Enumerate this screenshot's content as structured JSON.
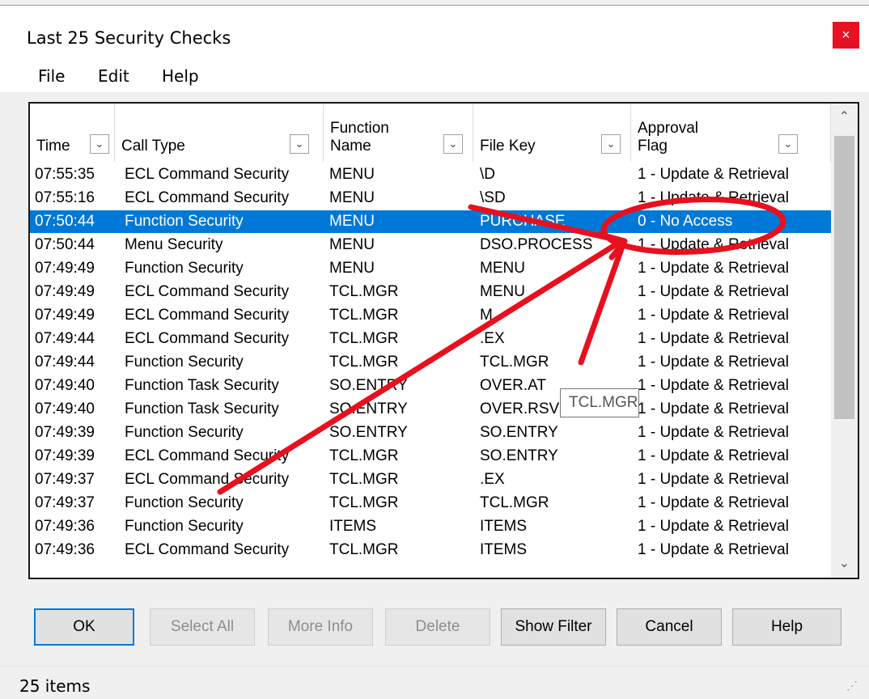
{
  "window": {
    "title": "Last 25 Security Checks",
    "close_glyph": "×"
  },
  "menu": [
    "File",
    "Edit",
    "Help"
  ],
  "columns": [
    {
      "label_line1": "",
      "label_line2": "Time"
    },
    {
      "label_line1": "",
      "label_line2": "Call Type"
    },
    {
      "label_line1": "Function",
      "label_line2": "Name"
    },
    {
      "label_line1": "",
      "label_line2": "File Key"
    },
    {
      "label_line1": "Approval",
      "label_line2": "Flag"
    }
  ],
  "rows": [
    [
      "07:55:35",
      "ECL Command Security",
      "MENU",
      "\\D",
      "1 - Update & Retrieval"
    ],
    [
      "07:55:16",
      "ECL Command Security",
      "MENU",
      "\\SD",
      "1 - Update & Retrieval"
    ],
    [
      "07:50:44",
      "Function Security",
      "MENU",
      "PURCHASE",
      "0 - No Access"
    ],
    [
      "07:50:44",
      "Menu Security",
      "MENU",
      "DSO.PROCESS",
      "1 - Update & Retrieval"
    ],
    [
      "07:49:49",
      "Function Security",
      "MENU",
      "MENU",
      "1 - Update & Retrieval"
    ],
    [
      "07:49:49",
      "ECL Command Security",
      "TCL.MGR",
      "MENU",
      "1 - Update & Retrieval"
    ],
    [
      "07:49:49",
      "ECL Command Security",
      "TCL.MGR",
      "M",
      "1 - Update & Retrieval"
    ],
    [
      "07:49:44",
      "ECL Command Security",
      "TCL.MGR",
      ".EX",
      "1 - Update & Retrieval"
    ],
    [
      "07:49:44",
      "Function Security",
      "TCL.MGR",
      "TCL.MGR",
      "1 - Update & Retrieval"
    ],
    [
      "07:49:40",
      "Function Task Security",
      "SO.ENTRY",
      "OVER.AT",
      "1 - Update & Retrieval"
    ],
    [
      "07:49:40",
      "Function Task Security",
      "SO.ENTRY",
      "OVER.RSV",
      "1 - Update & Retrieval"
    ],
    [
      "07:49:39",
      "Function Security",
      "SO.ENTRY",
      "SO.ENTRY",
      "1 - Update & Retrieval"
    ],
    [
      "07:49:39",
      "ECL Command Security",
      "TCL.MGR",
      "SO.ENTRY",
      "1 - Update & Retrieval"
    ],
    [
      "07:49:37",
      "ECL Command Security",
      "TCL.MGR",
      ".EX",
      "1 - Update & Retrieval"
    ],
    [
      "07:49:37",
      "Function Security",
      "TCL.MGR",
      "TCL.MGR",
      "1 - Update & Retrieval"
    ],
    [
      "07:49:36",
      "Function Security",
      "ITEMS",
      "ITEMS",
      "1 - Update & Retrieval"
    ],
    [
      "07:49:36",
      "ECL Command Security",
      "TCL.MGR",
      "ITEMS",
      "1 - Update & Retrieval"
    ]
  ],
  "selected_row": 2,
  "tooltip": "TCL.MGR",
  "buttons": [
    {
      "label": "OK",
      "enabled": true
    },
    {
      "label": "Select All",
      "enabled": false
    },
    {
      "label": "More Info",
      "enabled": false
    },
    {
      "label": "Delete",
      "enabled": false
    },
    {
      "label": "Show Filter",
      "enabled": true
    },
    {
      "label": "Cancel",
      "enabled": true
    },
    {
      "label": "Help",
      "enabled": true
    }
  ],
  "status": "25 items",
  "colors": {
    "selection": "#0078d7",
    "annotation": "#e8101e",
    "close": "#e81123"
  }
}
